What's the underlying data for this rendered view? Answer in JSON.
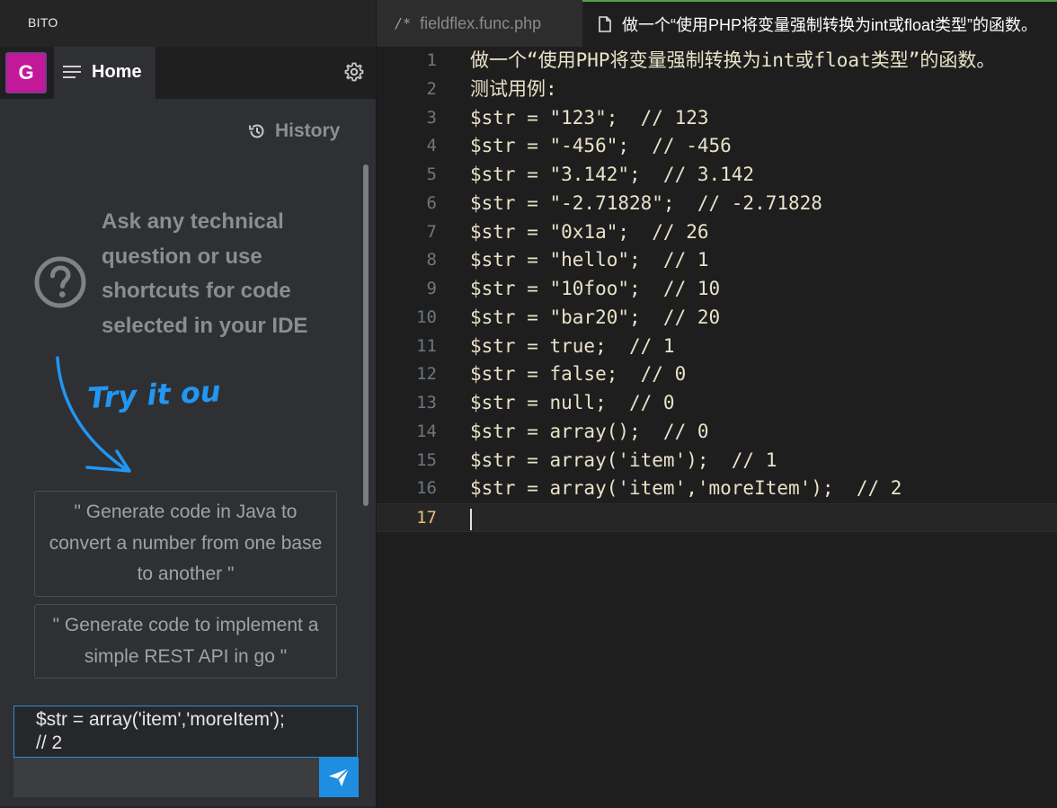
{
  "left_panel": {
    "app_title": "BITO",
    "avatar_letter": "G",
    "home_label": "Home",
    "history_label": "History",
    "ask_text": "Ask any technical question or use shortcuts for code selected in your IDE",
    "try_it_out": "Try it out",
    "suggestions": [
      "\" Generate code in Java to convert a number from one base to another \"",
      "\" Generate code to implement a simple REST API in go \""
    ],
    "input_value": "$str = array('item','moreItem');\n// 2",
    "accent_color": "#1f8ee0",
    "avatar_color": "#c2189a"
  },
  "editor": {
    "tabs": [
      {
        "icon": "/*",
        "label": "fieldflex.func.php"
      },
      {
        "icon": "file-icon",
        "label": "做一个“使用PHP将变量强制转换为int或float类型”的函数。"
      }
    ],
    "active_line": 17,
    "lines": [
      {
        "num": "1",
        "text": "做一个“使用PHP将变量强制转换为int或float类型”的函数。"
      },
      {
        "num": "2",
        "text": "测试用例:"
      },
      {
        "num": "3",
        "text": "$str = \"123\";  // 123"
      },
      {
        "num": "4",
        "text": "$str = \"-456\";  // -456"
      },
      {
        "num": "5",
        "text": "$str = \"3.142\";  // 3.142"
      },
      {
        "num": "6",
        "text": "$str = \"-2.71828\";  // -2.71828"
      },
      {
        "num": "7",
        "text": "$str = \"0x1a\";  // 26"
      },
      {
        "num": "8",
        "text": "$str = \"hello\";  // 1"
      },
      {
        "num": "9",
        "text": "$str = \"10foo\";  // 10"
      },
      {
        "num": "10",
        "text": "$str = \"bar20\";  // 20"
      },
      {
        "num": "11",
        "text": "$str = true;  // 1"
      },
      {
        "num": "12",
        "text": "$str = false;  // 0"
      },
      {
        "num": "13",
        "text": "$str = null;  // 0"
      },
      {
        "num": "14",
        "text": "$str = array();  // 0"
      },
      {
        "num": "15",
        "text": "$str = array('item');  // 1"
      },
      {
        "num": "16",
        "text": "$str = array('item','moreItem');  // 2"
      },
      {
        "num": "17",
        "text": ""
      }
    ]
  }
}
